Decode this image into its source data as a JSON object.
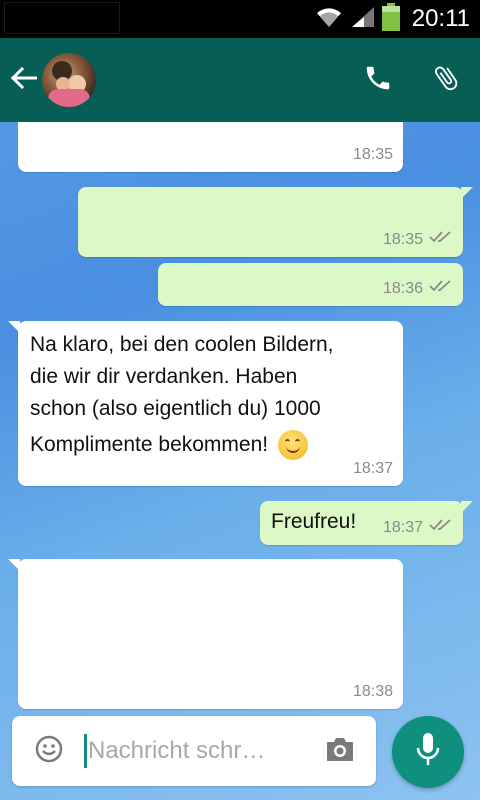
{
  "status_bar": {
    "time": "20:11",
    "icons": [
      "wifi-icon",
      "signal-icon",
      "battery-icon"
    ]
  },
  "app_bar": {
    "icons": [
      "back-arrow-icon",
      "phone-icon",
      "paperclip-icon"
    ]
  },
  "messages": [
    {
      "direction": "in",
      "text": "",
      "time": "18:35",
      "read": false
    },
    {
      "direction": "out",
      "text": "",
      "time": "18:35",
      "read": true
    },
    {
      "direction": "out",
      "text": "",
      "time": "18:36",
      "read": true
    },
    {
      "direction": "in",
      "lines": [
        "Na klaro, bei den coolen Bildern,",
        "die wir dir verdanken. Haben",
        "schon (also eigentlich du) 1000",
        "Komplimente bekommen!"
      ],
      "emoji": "smiling-face-icon",
      "time": "18:37",
      "read": false
    },
    {
      "direction": "out",
      "text": "Freufreu!",
      "time": "18:37",
      "read": true
    },
    {
      "direction": "in",
      "text": "",
      "time": "18:38",
      "read": false
    }
  ],
  "composer": {
    "placeholder": "Nachricht schr…",
    "icons": [
      "emoji-icon",
      "camera-icon",
      "microphone-icon"
    ]
  },
  "colors": {
    "app_bar": "#075e54",
    "incoming_bubble": "#ffffff",
    "outgoing_bubble": "#dcf8c6",
    "accent": "#0f8f7e",
    "read_ticks": "#8a8a8a"
  }
}
